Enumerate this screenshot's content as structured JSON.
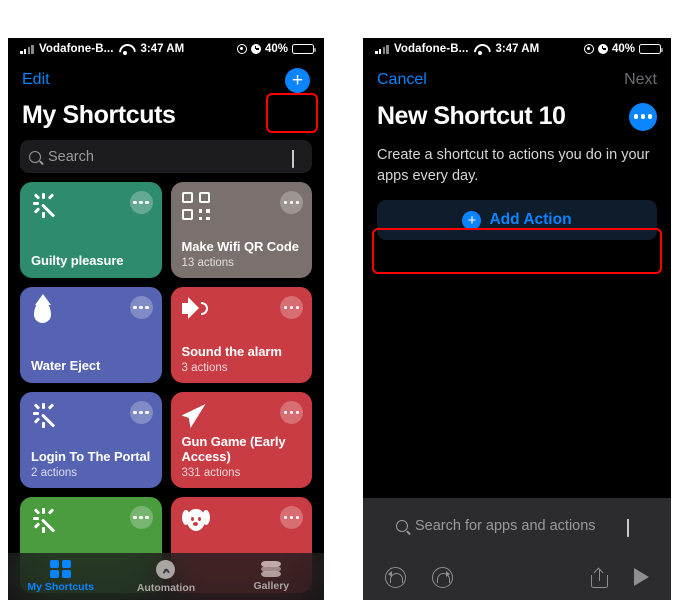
{
  "status_bar": {
    "carrier": "Vodafone-B...",
    "time": "3:47 AM",
    "battery_percent": "40%",
    "wifi_icon": "wifi-icon",
    "signal_icon": "signal-bars-icon",
    "location_icon": "location-services-icon",
    "alarm_icon": "alarm-clock-icon",
    "battery_icon": "battery-icon"
  },
  "left_screen": {
    "nav": {
      "edit_label": "Edit",
      "add_icon": "plus-icon"
    },
    "title": "My Shortcuts",
    "search": {
      "placeholder": "Search",
      "search_icon": "search-icon",
      "mic_icon": "microphone-icon"
    },
    "cards": [
      {
        "title": "Guilty pleasure",
        "subtitle": "",
        "color": "#2e8b6e",
        "icon": "magic-wand-icon"
      },
      {
        "title": "Make Wifi QR Code",
        "subtitle": "13 actions",
        "color": "#7a706d",
        "icon": "qr-code-icon"
      },
      {
        "title": "Water Eject",
        "subtitle": "",
        "color": "#5663b3",
        "icon": "water-drop-icon"
      },
      {
        "title": "Sound the alarm",
        "subtitle": "3 actions",
        "color": "#c93c44",
        "icon": "speaker-icon"
      },
      {
        "title": "Login To The Portal",
        "subtitle": "2 actions",
        "color": "#5663b3",
        "icon": "magic-wand-icon"
      },
      {
        "title": "Gun Game (Early Access)",
        "subtitle": "331 actions",
        "color": "#c93c44",
        "icon": "navigation-arrow-icon"
      },
      {
        "title": "",
        "subtitle": "",
        "color": "#4a9c3e",
        "icon": "magic-wand-icon"
      },
      {
        "title": "",
        "subtitle": "",
        "color": "#c93c44",
        "icon": "dog-face-icon"
      }
    ],
    "card_menu_icon": "ellipsis-icon",
    "tabs": [
      {
        "label": "My Shortcuts",
        "icon": "grid-squares-icon",
        "active": true
      },
      {
        "label": "Automation",
        "icon": "clock-icon",
        "active": false
      },
      {
        "label": "Gallery",
        "icon": "layers-icon",
        "active": false
      }
    ]
  },
  "right_screen": {
    "nav": {
      "cancel_label": "Cancel",
      "next_label": "Next"
    },
    "title": "New Shortcut 10",
    "more_icon": "ellipsis-icon",
    "description": "Create a shortcut to actions you do in your apps every day.",
    "add_action": {
      "label": "Add Action",
      "icon": "plus-circle-icon"
    },
    "search": {
      "placeholder": "Search for apps and actions",
      "search_icon": "search-icon",
      "mic_icon": "microphone-icon"
    },
    "toolbar": [
      {
        "name": "undo-button",
        "icon": "undo-icon"
      },
      {
        "name": "redo-button",
        "icon": "redo-icon"
      },
      {
        "name": "share-button",
        "icon": "share-icon"
      },
      {
        "name": "run-button",
        "icon": "play-icon"
      }
    ]
  },
  "annotations": {
    "highlight_color": "#ff0000",
    "boxes": [
      "add-shortcut-button-highlight",
      "add-action-button-highlight"
    ]
  }
}
